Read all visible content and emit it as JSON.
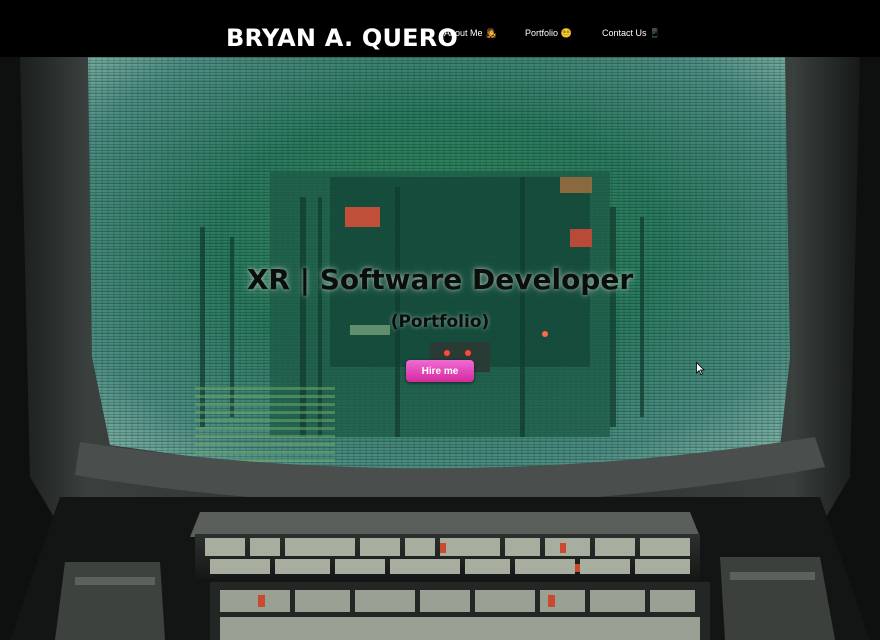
{
  "header": {
    "brand": "BRYAN A. QUERO",
    "nav": [
      {
        "label": "About Me",
        "emoji": "🧑‍🎤"
      },
      {
        "label": "Portfolio",
        "emoji": "😵‍💫"
      },
      {
        "label": "Contact Us",
        "emoji": "📱"
      }
    ]
  },
  "hero": {
    "title": "XR | Software Developer",
    "subtitle": "(Portfolio)",
    "cta_label": "Hire me",
    "cta_color": "#e23eb3",
    "background_image": "retro computer terminal with green glowing screen and keyboard"
  }
}
